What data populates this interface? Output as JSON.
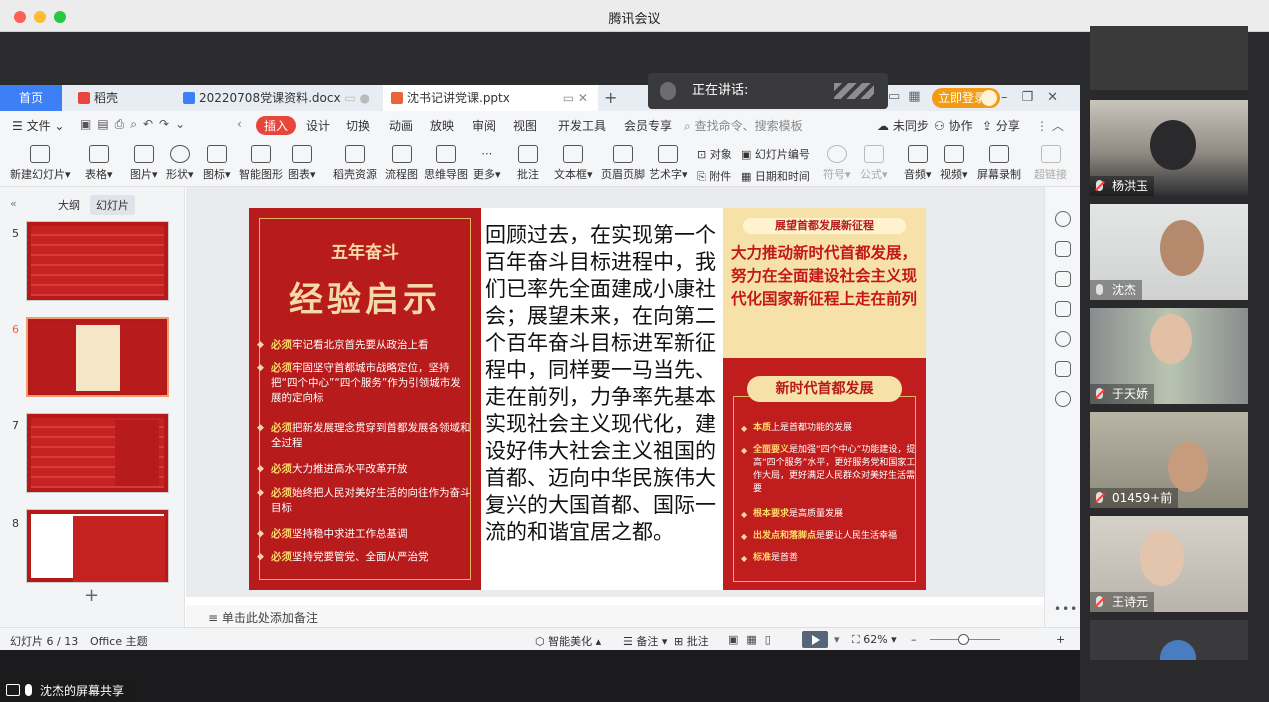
{
  "window": {
    "title": "腾讯会议"
  },
  "speaker_bar": {
    "label": "正在讲话:"
  },
  "tabs": [
    {
      "label": "首页"
    },
    {
      "label": "稻壳"
    },
    {
      "label": "20220708党课资料.docx"
    },
    {
      "label": "沈书记讲党课.pptx"
    }
  ],
  "login_button": "立即登录",
  "menu": [
    "文件",
    "插入",
    "设计",
    "切换",
    "动画",
    "放映",
    "审阅",
    "视图",
    "开发工具",
    "会员专享"
  ],
  "menu_active": "插入",
  "search": {
    "placeholder": "查找命令、搜索模板"
  },
  "menu_right": [
    "未同步",
    "协作",
    "分享"
  ],
  "ribbon": [
    {
      "label": "新建幻灯片",
      "icon": "new-slide-icon"
    },
    {
      "label": "表格",
      "icon": "table-icon"
    },
    {
      "label": "图片",
      "icon": "image-icon"
    },
    {
      "label": "形状",
      "icon": "shape-icon"
    },
    {
      "label": "图标",
      "icon": "icons-icon"
    },
    {
      "label": "智能图形",
      "icon": "smartart-icon"
    },
    {
      "label": "图表",
      "icon": "chart-icon"
    },
    {
      "label": "稻壳资源",
      "icon": "resource-icon"
    },
    {
      "label": "流程图",
      "icon": "flowchart-icon"
    },
    {
      "label": "思维导图",
      "icon": "mindmap-icon"
    },
    {
      "label": "更多",
      "icon": "more-icon"
    },
    {
      "label": "批注",
      "icon": "comment-icon"
    },
    {
      "label": "文本框",
      "icon": "textbox-icon"
    },
    {
      "label": "页眉页脚",
      "icon": "header-footer-icon"
    },
    {
      "label": "艺术字",
      "icon": "wordart-icon"
    },
    {
      "label": "符号",
      "icon": "symbol-icon"
    },
    {
      "label": "公式",
      "icon": "formula-icon"
    },
    {
      "label": "音频",
      "icon": "audio-icon"
    },
    {
      "label": "视频",
      "icon": "video-icon"
    },
    {
      "label": "屏幕录制",
      "icon": "screen-record-icon"
    },
    {
      "label": "超链接",
      "icon": "hyperlink-icon"
    }
  ],
  "ribbon_small": [
    "对象",
    "幻灯片编号",
    "附件",
    "日期和时间"
  ],
  "left_panel": {
    "tabs": [
      "大纲",
      "幻灯片"
    ],
    "active_tab": "幻灯片",
    "slide_numbers": [
      "5",
      "6",
      "7",
      "8"
    ]
  },
  "slide": {
    "left": {
      "title1": "五年奋斗",
      "title2": "经验启示",
      "items": [
        {
          "bold": "必须",
          "text": "牢记看北京首先要从政治上看"
        },
        {
          "bold": "必须",
          "text": "牢固坚守首都城市战略定位，坚持把“四个中心”“四个服务”作为引领城市发展的定向标"
        },
        {
          "bold": "必须",
          "text": "把新发展理念贯穿到首都发展各领域和全过程"
        },
        {
          "bold": "必须",
          "text": "大力推进高水平改革开放"
        },
        {
          "bold": "必须",
          "text": "始终把人民对美好生活的向往作为奋斗目标"
        },
        {
          "bold": "必须",
          "text": "坚持稳中求进工作总基调"
        },
        {
          "bold": "必须",
          "text": "坚持党要管党、全面从严治党"
        }
      ]
    },
    "middle_text": "回顾过去，在实现第一个百年奋斗目标进程中，我们已率先全面建成小康社会；展望未来，在向第二个百年奋斗目标进军新征程中，同样要一马当先、走在前列，力争率先基本实现社会主义现代化，建设好伟大社会主义祖国的首都、迈向中华民族伟大复兴的大国首都、国际一流的和谐宜居之都。",
    "right": {
      "banner": "展望首都发展新征程",
      "headline": "大力推动新时代首都发展，努力在全面建设社会主义现代化国家新征程上走在前列",
      "subtitle": "新时代首都发展",
      "items": [
        {
          "bold": "本质",
          "text": "上是首都功能的发展"
        },
        {
          "bold": "全面要义",
          "text": "是加强“四个中心”功能建设，提高“四个服务”水平，更好服务党和国家工作大局，更好满足人民群众对美好生活需要"
        },
        {
          "bold": "根本要求",
          "text": "是高质量发展"
        },
        {
          "bold": "出发点和落脚点",
          "text": "是要让人民生活幸福"
        },
        {
          "bold": "标准",
          "text": "是首善"
        }
      ]
    }
  },
  "notes_placeholder": "单击此处添加备注",
  "status": {
    "slide_info": "幻灯片 6 / 13",
    "theme": "Office 主题",
    "beautify": "智能美化",
    "notes": "备注",
    "comment": "批注",
    "zoom": "62%"
  },
  "screen_share_label": "沈杰的屏幕共享",
  "participants": [
    {
      "name": "杨洪玉"
    },
    {
      "name": "沈杰"
    },
    {
      "name": "于天娇"
    },
    {
      "name": "01459+前"
    },
    {
      "name": "王诗元"
    }
  ],
  "colors": {
    "accent_red": "#b71b1b",
    "gold": "#f6e2a8",
    "wps_blue": "#3d7ff5",
    "login_orange": "#f29b15"
  }
}
